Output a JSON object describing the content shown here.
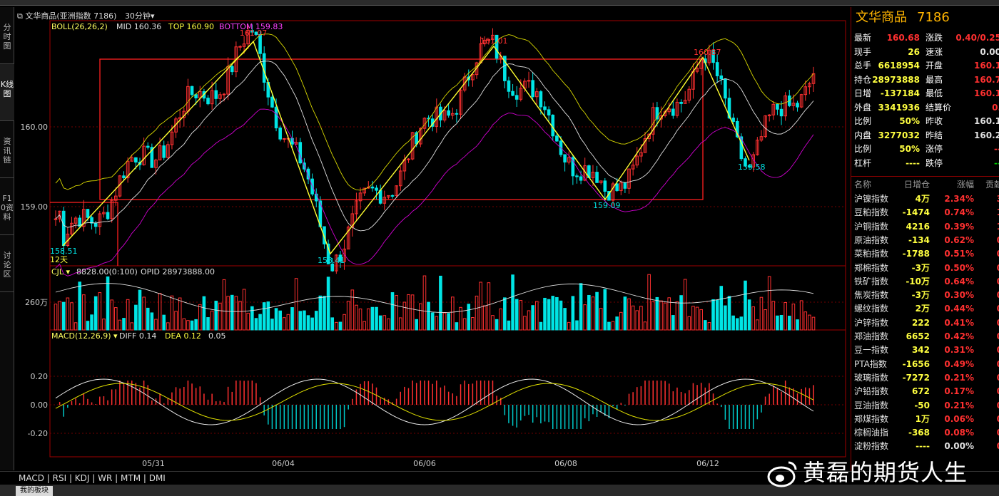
{
  "chart_header": {
    "icon": "window-icon",
    "title": "文华商品(亚洲指数 7186)",
    "period": "30分钟"
  },
  "rail_tabs": [
    {
      "label": "分时图"
    },
    {
      "label": "K线图"
    },
    {
      "label": "资讯链"
    },
    {
      "label": "F10资料"
    },
    {
      "label": "讨论区"
    }
  ],
  "boll": {
    "label": "BOLL(26,26,2)",
    "mid": "MID 160.36",
    "top": "TOP 160.90",
    "bottom": "BOTTOM 159.83"
  },
  "cjl": {
    "label": "CJL",
    "value": "8828.00(0:100)",
    "opid": "OPID 28973888.00",
    "axis": "260万"
  },
  "macd": {
    "label": "MACD(12,26,9)",
    "diff": "DIFF 0.14",
    "dea": "DEA 0.12",
    "val": "0.05"
  },
  "price_axis": [
    "160.00",
    "159.00"
  ],
  "macd_axis": [
    "0.20",
    "0.00",
    "-0.20"
  ],
  "date_axis": [
    "05/31",
    "06/04",
    "06/06",
    "06/08",
    "06/12"
  ],
  "annotations": [
    "161.07",
    "158.51",
    "12天",
    "158.41",
    "161.01",
    "159.09",
    "160.87",
    "159.58"
  ],
  "bottom_tabs": "MACD | RSI | KDJ | WR | MTM | DMI",
  "status_tab": "我的板块",
  "watermark": "黄磊的期货人生",
  "quote": {
    "name": "文华商品",
    "code": "7186",
    "rows": [
      {
        "l1": "最新",
        "v1": "160.68",
        "c1": "red",
        "l2": "涨跌",
        "v2": "0.40/0.25",
        "c2": "red"
      },
      {
        "l1": "现手",
        "v1": "26",
        "c1": "yellow",
        "l2": "速涨",
        "v2": "0.00",
        "c2": "white"
      },
      {
        "l1": "总手",
        "v1": "6618954",
        "c1": "yellow",
        "l2": "开盘",
        "v2": "160.1",
        "c2": "red"
      },
      {
        "l1": "持仓",
        "v1": "28973888",
        "c1": "yellow",
        "l2": "最高",
        "v2": "160.7",
        "c2": "red"
      },
      {
        "l1": "日增",
        "v1": "-137184",
        "c1": "yellow",
        "l2": "最低",
        "v2": "160.1",
        "c2": "red"
      },
      {
        "l1": "外盘",
        "v1": "3341936",
        "c1": "yellow",
        "l2": "结算价",
        "v2": "0.",
        "c2": "red"
      },
      {
        "l1": "比例",
        "v1": "50%",
        "c1": "yellow",
        "l2": "昨收",
        "v2": "160.1",
        "c2": "white"
      },
      {
        "l1": "内盘",
        "v1": "3277032",
        "c1": "yellow",
        "l2": "昨结",
        "v2": "160.2",
        "c2": "white"
      },
      {
        "l1": "比例",
        "v1": "50%",
        "c1": "yellow",
        "l2": "涨停",
        "v2": "--",
        "c2": "red"
      },
      {
        "l1": "杠杆",
        "v1": "----",
        "c1": "yellow",
        "l2": "跌停",
        "v2": "--",
        "c2": "green"
      }
    ]
  },
  "list_head": {
    "name": "名称",
    "a": "日增仓",
    "b": "涨幅",
    "c": "贡献"
  },
  "list": [
    {
      "n": "沪镍指数",
      "a": "4万",
      "b": "2.34%",
      "c": "3"
    },
    {
      "n": "豆粕指数",
      "a": "-1474",
      "b": "0.74%",
      "c": "1"
    },
    {
      "n": "沪铜指数",
      "a": "4216",
      "b": "0.39%",
      "c": "1"
    },
    {
      "n": "原油指数",
      "a": "-134",
      "b": "0.62%",
      "c": "0"
    },
    {
      "n": "菜粕指数",
      "a": "-1788",
      "b": "0.51%",
      "c": "0"
    },
    {
      "n": "郑棉指数",
      "a": "-3万",
      "b": "0.50%",
      "c": "0"
    },
    {
      "n": "铁矿指数",
      "a": "-10万",
      "b": "0.64%",
      "c": "0"
    },
    {
      "n": "焦炭指数",
      "a": "-3万",
      "b": "0.30%",
      "c": "0"
    },
    {
      "n": "螺纹指数",
      "a": "2万",
      "b": "0.44%",
      "c": "0"
    },
    {
      "n": "沪锌指数",
      "a": "222",
      "b": "0.41%",
      "c": "0"
    },
    {
      "n": "郑油指数",
      "a": "6652",
      "b": "0.42%",
      "c": "0"
    },
    {
      "n": "豆一指数",
      "a": "342",
      "b": "0.31%",
      "c": "0"
    },
    {
      "n": "PTA指数",
      "a": "-1656",
      "b": "0.49%",
      "c": "0"
    },
    {
      "n": "玻璃指数",
      "a": "-7272",
      "b": "0.21%",
      "c": "0"
    },
    {
      "n": "沪铅指数",
      "a": "672",
      "b": "0.17%",
      "c": "0"
    },
    {
      "n": "豆油指数",
      "a": "-50",
      "b": "0.21%",
      "c": "0"
    },
    {
      "n": "郑煤指数",
      "a": "1万",
      "b": "0.06%",
      "c": "0"
    },
    {
      "n": "棕榈油指",
      "a": "-368",
      "b": "0.08%",
      "c": "0"
    },
    {
      "n": "淀粉指数",
      "a": "----",
      "b": "0.00%",
      "c": "0"
    }
  ]
}
